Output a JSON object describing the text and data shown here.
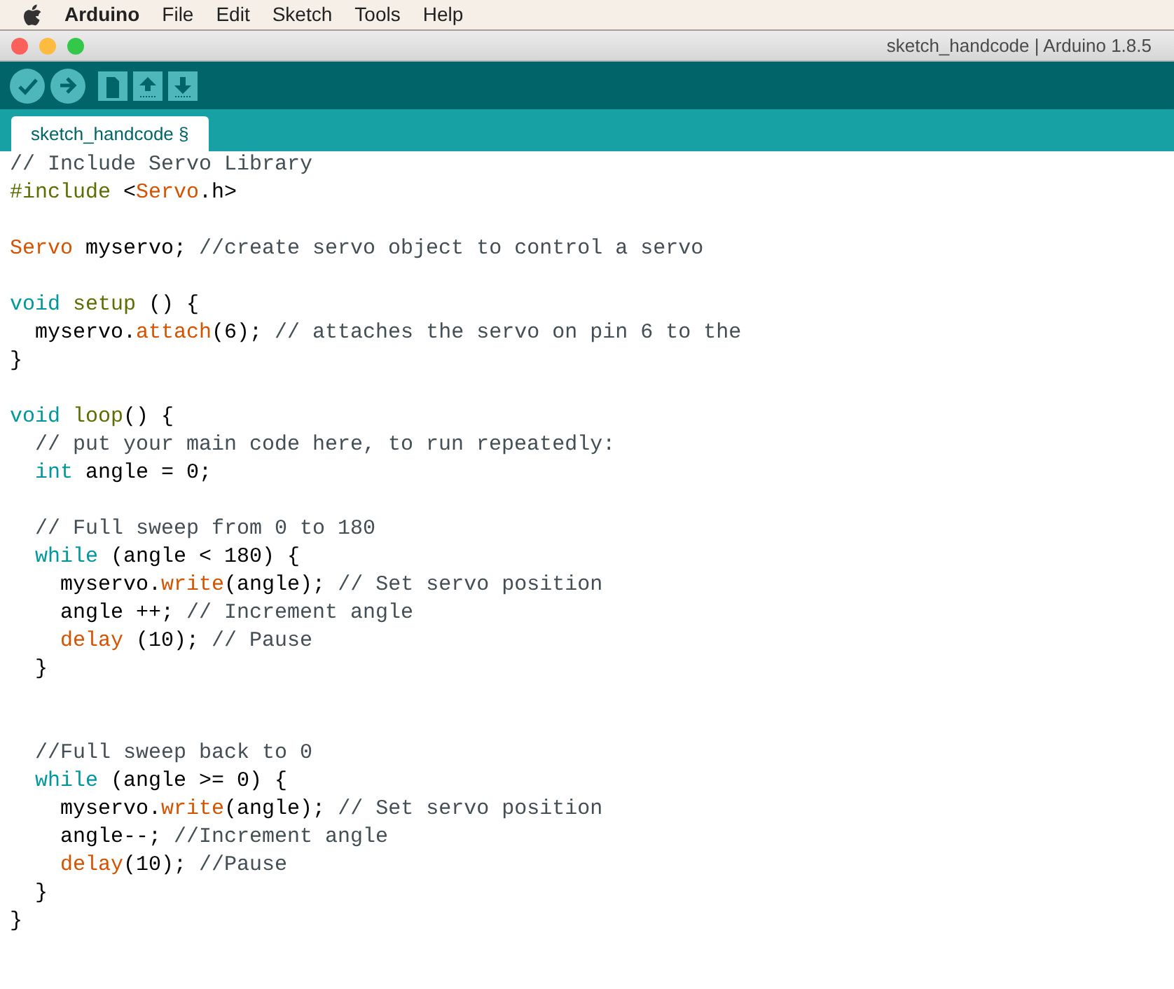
{
  "menu_bar": {
    "app": "Arduino",
    "items": [
      "File",
      "Edit",
      "Sketch",
      "Tools",
      "Help"
    ]
  },
  "window": {
    "title": "sketch_handcode | Arduino 1.8.5"
  },
  "toolbar": [
    {
      "kind": "verify"
    },
    {
      "kind": "upload"
    },
    {
      "kind": "new"
    },
    {
      "kind": "open"
    },
    {
      "kind": "save"
    }
  ],
  "tabs": [
    {
      "label": "sketch_handcode §",
      "selected": true
    }
  ],
  "code_lines": [
    {
      "kind": "code",
      "tokens": [
        {
          "kind": "comment",
          "text": "// Include Servo Library"
        }
      ]
    },
    {
      "kind": "code",
      "tokens": [
        {
          "kind": "function",
          "text": "#include"
        },
        {
          "kind": "plain",
          "text": " <"
        },
        {
          "kind": "type",
          "text": "Servo"
        },
        {
          "kind": "plain",
          "text": ".h>"
        }
      ]
    },
    {
      "kind": "blank"
    },
    {
      "kind": "code",
      "tokens": [
        {
          "kind": "type",
          "text": "Servo"
        },
        {
          "kind": "plain",
          "text": " myservo; "
        },
        {
          "kind": "comment",
          "text": "//create servo object to control a servo"
        }
      ]
    },
    {
      "kind": "blank"
    },
    {
      "kind": "code",
      "tokens": [
        {
          "kind": "keyword",
          "text": "void"
        },
        {
          "kind": "function",
          "text": " setup"
        },
        {
          "kind": "plain",
          "text": " () {"
        }
      ]
    },
    {
      "kind": "code",
      "tokens": [
        {
          "kind": "plain",
          "text": "  myservo."
        },
        {
          "kind": "type",
          "text": "attach"
        },
        {
          "kind": "plain",
          "text": "(6); "
        },
        {
          "kind": "comment",
          "text": "// attaches the servo on pin 6 to the"
        }
      ]
    },
    {
      "kind": "code",
      "tokens": [
        {
          "kind": "plain",
          "text": "}"
        }
      ]
    },
    {
      "kind": "blank"
    },
    {
      "kind": "code",
      "tokens": [
        {
          "kind": "keyword",
          "text": "void"
        },
        {
          "kind": "function",
          "text": " loop"
        },
        {
          "kind": "plain",
          "text": "() {"
        }
      ]
    },
    {
      "kind": "code",
      "tokens": [
        {
          "kind": "comment",
          "text": "  // put your main code here, to run repeatedly:"
        }
      ]
    },
    {
      "kind": "code",
      "tokens": [
        {
          "kind": "keyword",
          "text": "  int"
        },
        {
          "kind": "plain",
          "text": " angle = 0;"
        }
      ]
    },
    {
      "kind": "blank"
    },
    {
      "kind": "code",
      "tokens": [
        {
          "kind": "comment",
          "text": "  // Full sweep from 0 to 180"
        }
      ]
    },
    {
      "kind": "code",
      "tokens": [
        {
          "kind": "keyword",
          "text": "  while"
        },
        {
          "kind": "plain",
          "text": " (angle < 180) {"
        }
      ]
    },
    {
      "kind": "code",
      "tokens": [
        {
          "kind": "plain",
          "text": "    myservo."
        },
        {
          "kind": "type",
          "text": "write"
        },
        {
          "kind": "plain",
          "text": "(angle); "
        },
        {
          "kind": "comment",
          "text": "// Set servo position"
        }
      ]
    },
    {
      "kind": "code",
      "tokens": [
        {
          "kind": "plain",
          "text": "    angle ++; "
        },
        {
          "kind": "comment",
          "text": "// Increment angle"
        }
      ]
    },
    {
      "kind": "code",
      "tokens": [
        {
          "kind": "type",
          "text": "    delay"
        },
        {
          "kind": "plain",
          "text": " (10); "
        },
        {
          "kind": "comment",
          "text": "// Pause"
        }
      ]
    },
    {
      "kind": "code",
      "tokens": [
        {
          "kind": "plain",
          "text": "  }"
        }
      ]
    },
    {
      "kind": "blank"
    },
    {
      "kind": "blank"
    },
    {
      "kind": "code",
      "tokens": [
        {
          "kind": "comment",
          "text": "  //Full sweep back to 0"
        }
      ]
    },
    {
      "kind": "code",
      "tokens": [
        {
          "kind": "keyword",
          "text": "  while"
        },
        {
          "kind": "plain",
          "text": " (angle >= 0) {"
        }
      ]
    },
    {
      "kind": "code",
      "tokens": [
        {
          "kind": "plain",
          "text": "    myservo."
        },
        {
          "kind": "type",
          "text": "write"
        },
        {
          "kind": "plain",
          "text": "(angle); "
        },
        {
          "kind": "comment",
          "text": "// Set servo position"
        }
      ]
    },
    {
      "kind": "code",
      "tokens": [
        {
          "kind": "plain",
          "text": "    angle--; "
        },
        {
          "kind": "comment",
          "text": "//Increment angle"
        }
      ]
    },
    {
      "kind": "code",
      "tokens": [
        {
          "kind": "type",
          "text": "    delay"
        },
        {
          "kind": "plain",
          "text": "(10); "
        },
        {
          "kind": "comment",
          "text": "//Pause"
        }
      ]
    },
    {
      "kind": "code",
      "tokens": [
        {
          "kind": "plain",
          "text": "  }"
        }
      ]
    },
    {
      "kind": "code",
      "tokens": [
        {
          "kind": "plain",
          "text": "}"
        }
      ]
    }
  ]
}
